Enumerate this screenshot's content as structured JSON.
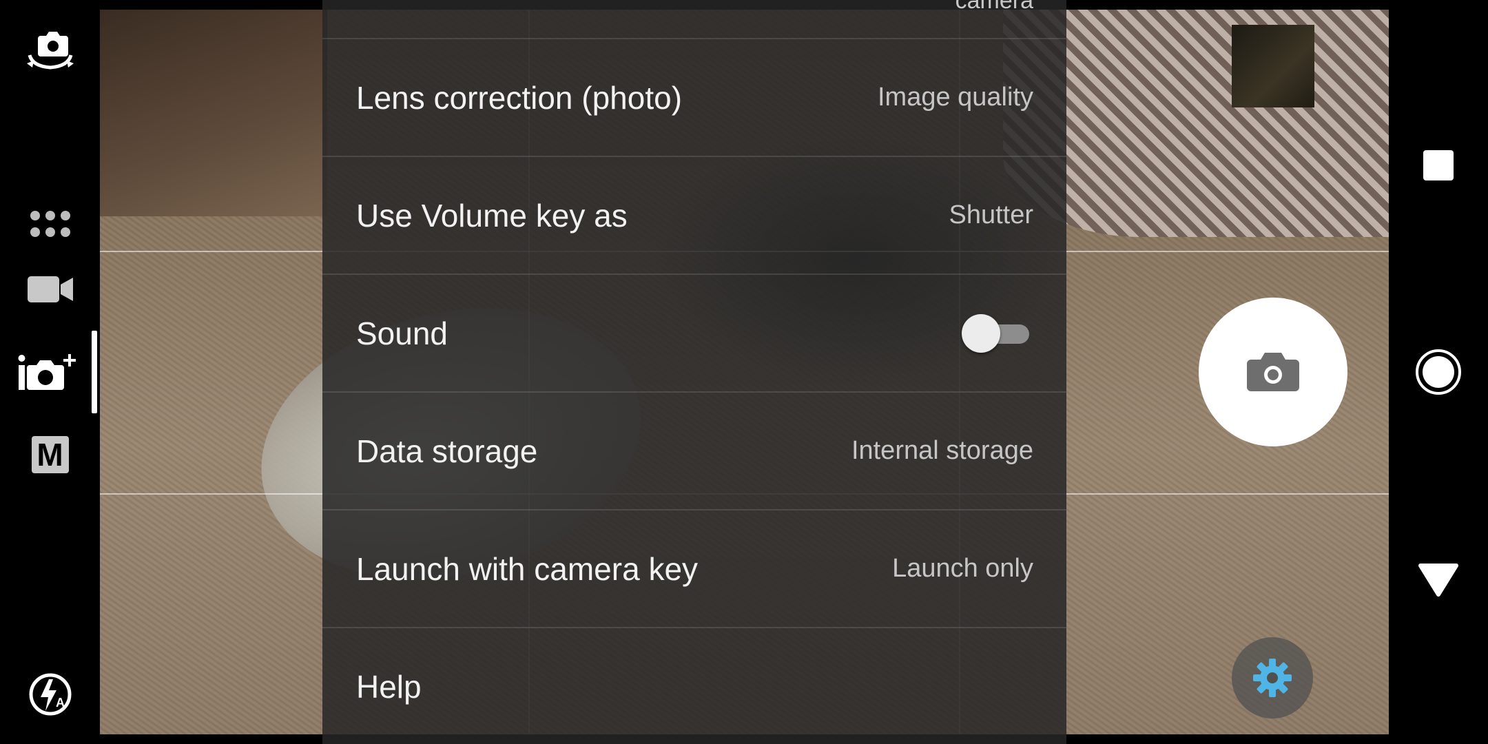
{
  "settings": {
    "top_partial_value": "camera",
    "rows": [
      {
        "label": "Lens correction (photo)",
        "value": "Image quality"
      },
      {
        "label": "Use Volume key as",
        "value": "Shutter"
      },
      {
        "label": "Sound",
        "toggle_on": false
      },
      {
        "label": "Data storage",
        "value": "Internal storage"
      },
      {
        "label": "Launch with camera key",
        "value": "Launch only"
      },
      {
        "label": "Help",
        "value": ""
      }
    ]
  },
  "left_rail": {
    "icons": [
      "switch-camera-icon",
      "more-modes-icon",
      "video-camera-icon",
      "superior-auto-icon",
      "manual-mode-icon",
      "flash-auto-icon"
    ],
    "manual_letter": "M",
    "active_mode": "superior-auto"
  },
  "right_controls": {
    "icons": [
      "gallery-thumbnail",
      "shutter-camera-icon",
      "settings-gear-icon"
    ],
    "accent_color": "#4fb4e6"
  },
  "nav_bar": {
    "icons": [
      "recent-apps-icon",
      "home-icon",
      "back-icon"
    ]
  }
}
